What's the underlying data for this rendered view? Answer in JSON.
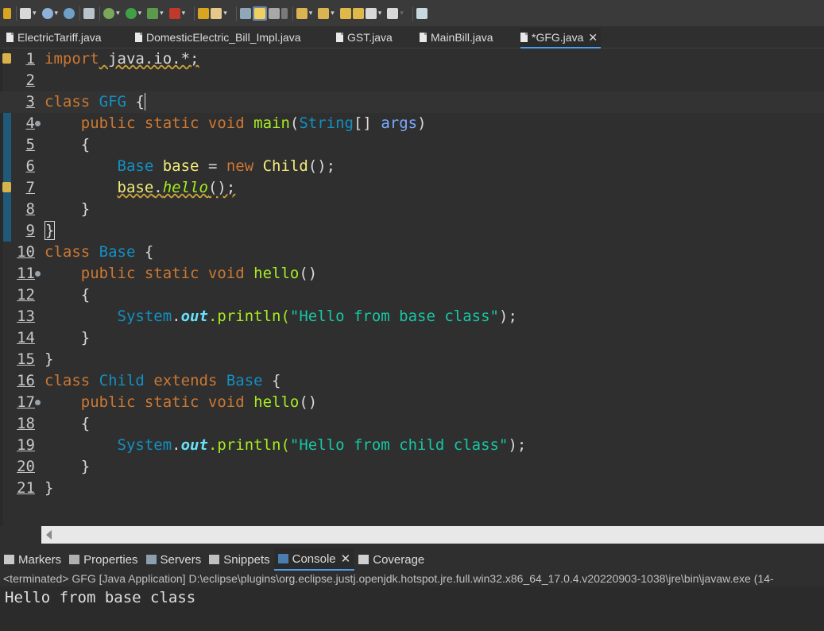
{
  "toolbar": {
    "icons": [
      "run-last-icon",
      "new-file-icon",
      "debug-icon",
      "globe-icon",
      "server-icon",
      "bug-icon",
      "run-icon",
      "run-coverage-icon",
      "external-tools-icon",
      "open-folder-icon",
      "pencil-icon",
      "toggle-block-icon",
      "mark-occurrences-icon",
      "word-wrap-icon",
      "pilcrow-icon",
      "next-annotation-icon",
      "prev-annotation-icon",
      "back-icon",
      "forward-icon",
      "new-window-icon"
    ]
  },
  "editor_tabs": [
    {
      "label": "ElectricTariff.java"
    },
    {
      "label": "DomesticElectric_Bill_Impl.java"
    },
    {
      "label": "GST.java"
    },
    {
      "label": "MainBill.java"
    },
    {
      "label": "*GFG.java",
      "active": true
    }
  ],
  "code": {
    "line_numbers": [
      "1",
      "2",
      "3",
      "4",
      "5",
      "6",
      "7",
      "8",
      "9",
      "10",
      "11",
      "12",
      "13",
      "14",
      "15",
      "16",
      "17",
      "18",
      "19",
      "20",
      "21"
    ],
    "tokens": {
      "l1_kw": "import",
      "l1_rest": " java.io.*;",
      "l3_kw": "class",
      "l3_name": "GFG",
      "l3_brace": " {",
      "l4_mods": "public static void",
      "l4_fn": "main",
      "l4_open": "(",
      "l4_type": "String",
      "l4_arr": "[] ",
      "l4_param": "args",
      "l4_close": ")",
      "l5": "{",
      "l6_type1": "Base",
      "l6_var": "base",
      "l6_eq": " = ",
      "l6_new": "new",
      "l6_child": " Child",
      "l6_end": "();",
      "l7_var": "base",
      "l7_dot": ".",
      "l7_call": "hello",
      "l7_end": "();",
      "l8": "}",
      "l9": "}",
      "l10_kw": "class",
      "l10_name": "Base",
      "l10_brace": " {",
      "l11_mods": "public static void",
      "l11_fn": "hello",
      "l11_end": "()",
      "l12": "{",
      "l13_sys": "System",
      "l13_dot1": ".",
      "l13_out": "out",
      "l13_print": ".println(",
      "l13_str": "\"Hello from base class\"",
      "l13_end": ");",
      "l14": "}",
      "l15": "}",
      "l16_kw": "class",
      "l16_name": "Child",
      "l16_ext": "extends",
      "l16_base": "Base",
      "l16_brace": " {",
      "l17_mods": "public static void",
      "l17_fn": "hello",
      "l17_end": "()",
      "l18": "{",
      "l19_sys": "System",
      "l19_dot1": ".",
      "l19_out": "out",
      "l19_print": ".println(",
      "l19_str": "\"Hello from child class\"",
      "l19_end": ");",
      "l20": "}",
      "l21": "}"
    }
  },
  "bottom_tabs": [
    {
      "label": "Markers"
    },
    {
      "label": "Properties"
    },
    {
      "label": "Servers"
    },
    {
      "label": "Snippets"
    },
    {
      "label": "Console",
      "active": true
    },
    {
      "label": "Coverage"
    }
  ],
  "console": {
    "status": "<terminated> GFG [Java Application] D:\\eclipse\\plugins\\org.eclipse.justj.openjdk.hotspot.jre.full.win32.x86_64_17.0.4.v20220903-1038\\jre\\bin\\javaw.exe  (14-",
    "output": "Hello from base class"
  },
  "colors": {
    "keyword": "#cc7832",
    "type": "#1290c3",
    "method": "#a7ec21",
    "string": "#17c6a3",
    "accent": "#4f9dea"
  }
}
